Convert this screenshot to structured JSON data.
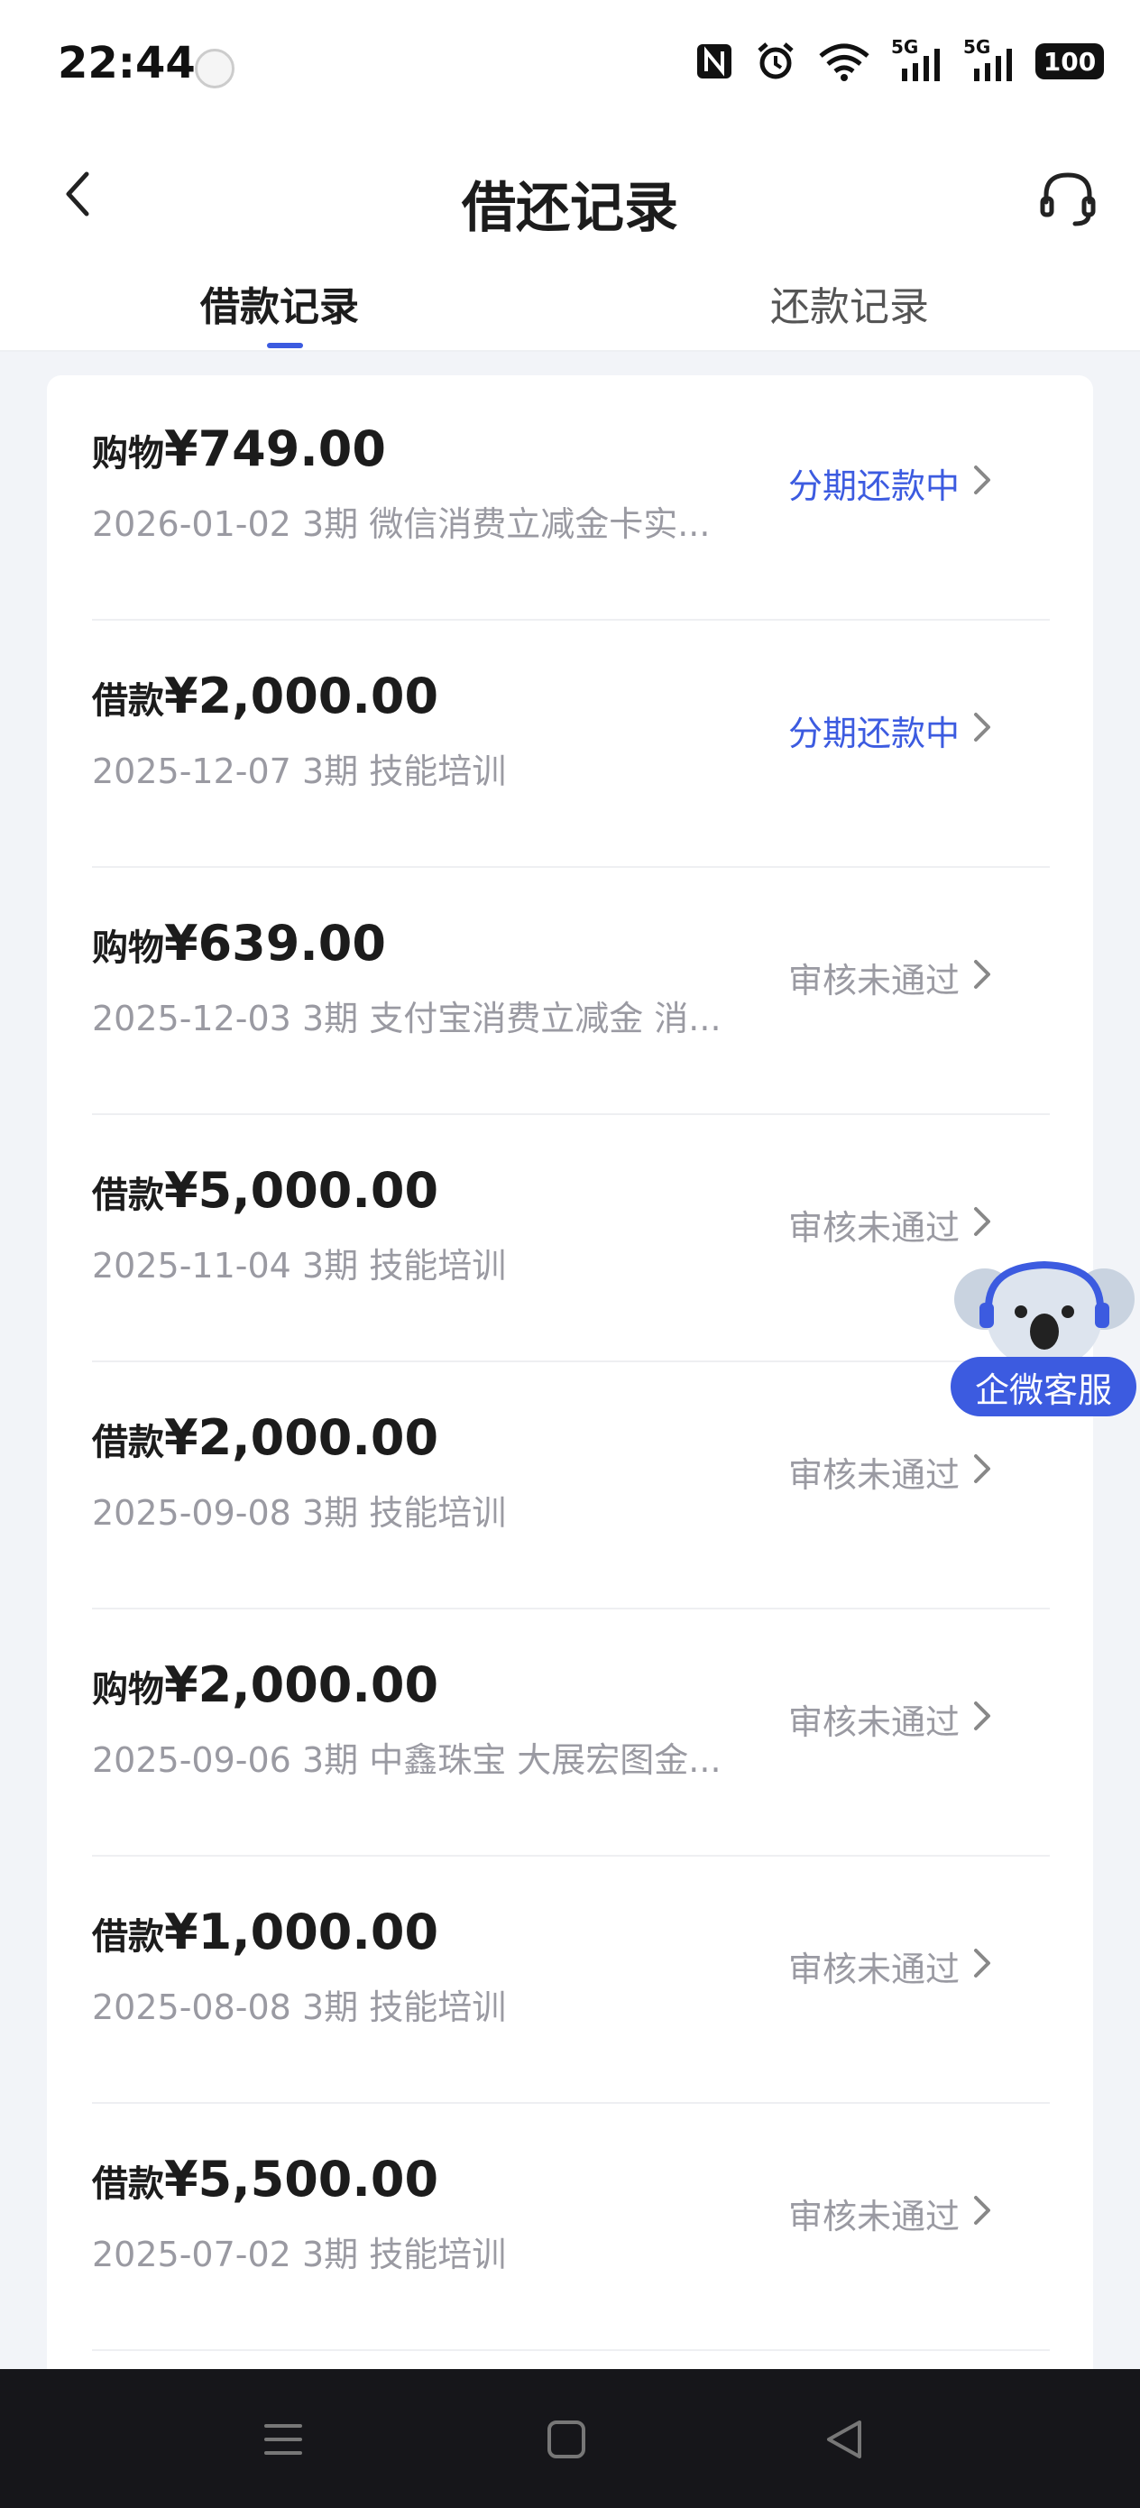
{
  "status_bar": {
    "time": "22:44",
    "battery": "100",
    "network_1": "5G",
    "network_2": "5G"
  },
  "nav": {
    "title": "借还记录"
  },
  "tabs": [
    {
      "label": "借款记录",
      "active": true
    },
    {
      "label": "还款记录",
      "active": false
    }
  ],
  "colors": {
    "accent": "#3c5be0",
    "status_active": "#3c5be0",
    "status_rejected": "#9a9aa2"
  },
  "records": [
    {
      "type": "购物",
      "amount": "¥749.00",
      "date": "2026-01-02",
      "periods": "3期",
      "desc": "微信消费立减金卡实...",
      "status": "分期还款中",
      "status_kind": "active"
    },
    {
      "type": "借款",
      "amount": "¥2,000.00",
      "date": "2025-12-07",
      "periods": "3期",
      "desc": "技能培训",
      "status": "分期还款中",
      "status_kind": "active"
    },
    {
      "type": "购物",
      "amount": "¥639.00",
      "date": "2025-12-03",
      "periods": "3期",
      "desc": "支付宝消费立减金 消...",
      "status": "审核未通过",
      "status_kind": "rejected"
    },
    {
      "type": "借款",
      "amount": "¥5,000.00",
      "date": "2025-11-04",
      "periods": "3期",
      "desc": "技能培训",
      "status": "审核未通过",
      "status_kind": "rejected"
    },
    {
      "type": "借款",
      "amount": "¥2,000.00",
      "date": "2025-09-08",
      "periods": "3期",
      "desc": "技能培训",
      "status": "审核未通过",
      "status_kind": "rejected"
    },
    {
      "type": "购物",
      "amount": "¥2,000.00",
      "date": "2025-09-06",
      "periods": "3期",
      "desc": "中鑫珠宝 大展宏图金...",
      "status": "审核未通过",
      "status_kind": "rejected"
    },
    {
      "type": "借款",
      "amount": "¥1,000.00",
      "date": "2025-08-08",
      "periods": "3期",
      "desc": "技能培训",
      "status": "审核未通过",
      "status_kind": "rejected"
    },
    {
      "type": "借款",
      "amount": "¥5,500.00",
      "date": "2025-07-02",
      "periods": "3期",
      "desc": "技能培训",
      "status": "审核未通过",
      "status_kind": "rejected"
    }
  ],
  "floating_service": {
    "label": "企微客服"
  }
}
